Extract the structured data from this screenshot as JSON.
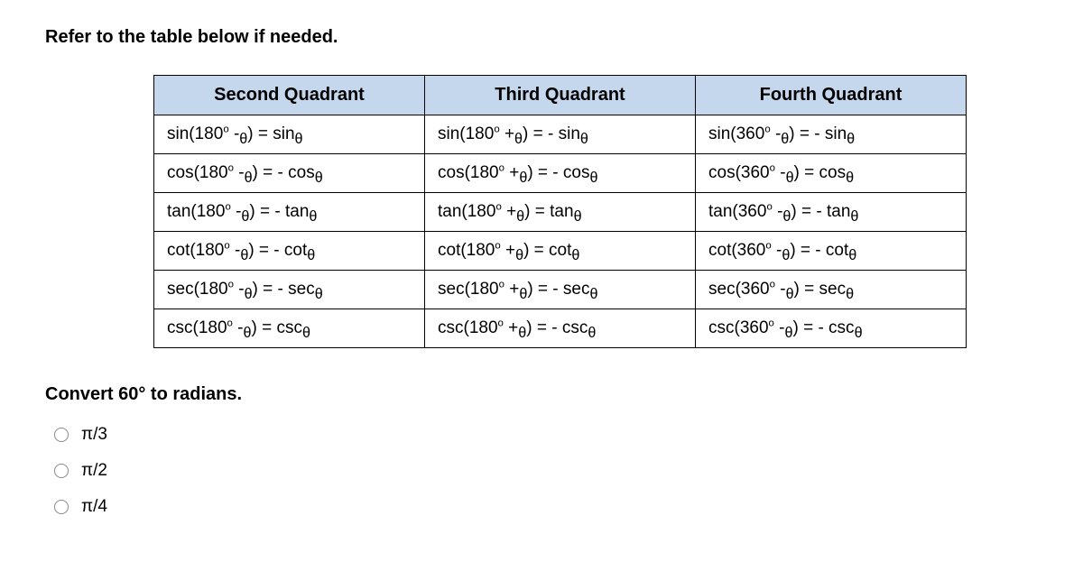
{
  "intro": "Refer to the table below if needed.",
  "table": {
    "headers": [
      "Second Quadrant",
      "Third Quadrant",
      "Fourth Quadrant"
    ],
    "rows": [
      {
        "second": "sin(180° -θ) = sinθ",
        "third": "sin(180° +θ) = - sinθ",
        "fourth": "sin(360° -θ) = - sinθ"
      },
      {
        "second": "cos(180° -θ) = - cosθ",
        "third": "cos(180° +θ) = - cosθ",
        "fourth": "cos(360° -θ) = cosθ"
      },
      {
        "second": "tan(180° -θ) = - tanθ",
        "third": "tan(180° +θ) = tanθ",
        "fourth": "tan(360° -θ) = - tanθ"
      },
      {
        "second": "cot(180° -θ) = - cotθ",
        "third": "cot(180° +θ) = cotθ",
        "fourth": "cot(360° -θ) = - cotθ"
      },
      {
        "second": "sec(180° -θ) = - secθ",
        "third": "sec(180° +θ) = - secθ",
        "fourth": "sec(360° -θ) = secθ"
      },
      {
        "second": "csc(180° -θ) = cscθ",
        "third": "csc(180° +θ) = - cscθ",
        "fourth": "csc(360° -θ) = - cscθ"
      }
    ]
  },
  "question": "Convert 60° to radians.",
  "options": [
    "π/3",
    "π/2",
    "π/4"
  ]
}
